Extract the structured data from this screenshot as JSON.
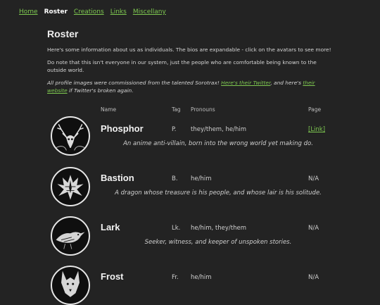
{
  "nav": {
    "items": [
      {
        "label": "Home",
        "active": false
      },
      {
        "label": "Roster",
        "active": true
      },
      {
        "label": "Creations",
        "active": false
      },
      {
        "label": "Links",
        "active": false
      },
      {
        "label": "Miscellany",
        "active": false
      }
    ]
  },
  "page": {
    "title": "Roster",
    "intro": "Here's some information about us as individuals. The bios are expandable - click on the avatars to see more!",
    "note": "Do note that this isn't everyone in our system, just the people who are comfortable being known to the outside world.",
    "credit_prefix": "All profile images were commissioned from the talented Sorotrax! ",
    "credit_twitter_link": "Here's their Twitter",
    "credit_middle": ", and here's ",
    "credit_website_link": "their website",
    "credit_suffix": " if Twitter's broken again."
  },
  "table": {
    "headers": {
      "name": "Name",
      "tag": "Tag",
      "pronouns": "Pronouns",
      "page": "Page"
    },
    "rows": [
      {
        "name": "Phosphor",
        "tag": "P.",
        "pronouns": "they/them, he/him",
        "page": "[Link]",
        "page_is_link": true,
        "bio": "An anime anti-villain, born into the wrong world yet making do.",
        "avatar_icon": "deer-skull-icon"
      },
      {
        "name": "Bastion",
        "tag": "B.",
        "pronouns": "he/him",
        "page": "N/A",
        "page_is_link": false,
        "bio": "A dragon whose treasure is his people, and whose lair is his solitude.",
        "avatar_icon": "dragon-icon"
      },
      {
        "name": "Lark",
        "tag": "Lk.",
        "pronouns": "he/him, they/them",
        "page": "N/A",
        "page_is_link": false,
        "bio": "Seeker, witness, and keeper of unspoken stories.",
        "avatar_icon": "raven-icon"
      },
      {
        "name": "Frost",
        "tag": "Fr.",
        "pronouns": "he/him",
        "page": "N/A",
        "page_is_link": false,
        "bio": "",
        "avatar_icon": "wolf-icon"
      }
    ]
  },
  "colors": {
    "background": "#232323",
    "link": "#7ec850",
    "text": "#d6d6d6"
  }
}
